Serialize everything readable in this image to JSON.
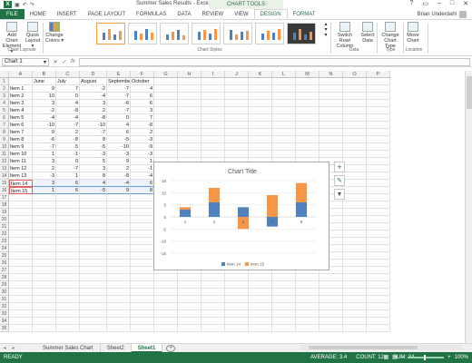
{
  "window": {
    "title": "Summer Sales Results - Excel",
    "chart_tools": "CHART TOOLS",
    "controls": [
      "?",
      "▭",
      "–",
      "□",
      "✕"
    ]
  },
  "user": {
    "name": "Brian Underdahl"
  },
  "tabs": [
    "FILE",
    "HOME",
    "INSERT",
    "PAGE LAYOUT",
    "FORMULAS",
    "DATA",
    "REVIEW",
    "VIEW",
    "DESIGN",
    "FORMAT"
  ],
  "ribbon": {
    "add_chart_element": "Add Chart Element ▾",
    "quick_layout": "Quick Layout ▾",
    "change_colors": "Change Colors ▾",
    "switch_row_column": "Switch Row/ Column",
    "select_data": "Select Data",
    "change_chart_type": "Change Chart Type",
    "move_chart": "Move Chart",
    "groups": {
      "chart_layouts": "Chart Layouts",
      "chart_styles": "Chart Styles",
      "data": "Data",
      "type": "Type",
      "location": "Location"
    }
  },
  "formula_bar": {
    "name_box": "Chart 1",
    "fx_cancel": "✕",
    "fx_ok": "✓",
    "fx": "fx",
    "value": ""
  },
  "columns": [
    "",
    "A",
    "B",
    "C",
    "D",
    "E",
    "F",
    "G",
    "H",
    "I",
    "J",
    "K",
    "L",
    "M",
    "N",
    "O",
    "P"
  ],
  "sheet_rows": [
    {
      "n": "1",
      "cells": [
        "",
        "June",
        "July",
        "August",
        "September",
        "October"
      ]
    },
    {
      "n": "2",
      "cells": [
        "Item 1",
        "9",
        "7",
        "-2",
        "-7",
        "4"
      ]
    },
    {
      "n": "3",
      "cells": [
        "Item 2",
        "10",
        "0",
        "-4",
        "-7",
        "6"
      ]
    },
    {
      "n": "4",
      "cells": [
        "Item 3",
        "3",
        "4",
        "3",
        "-6",
        "6"
      ]
    },
    {
      "n": "5",
      "cells": [
        "Item 4",
        "-2",
        "-8",
        "2",
        "-7",
        "3"
      ]
    },
    {
      "n": "6",
      "cells": [
        "Item 5",
        "-4",
        "-4",
        "-8",
        "0",
        "7"
      ]
    },
    {
      "n": "7",
      "cells": [
        "Item 6",
        "-10",
        "-7",
        "-10",
        "4",
        "-8"
      ]
    },
    {
      "n": "8",
      "cells": [
        "Item 7",
        "9",
        "2",
        "-7",
        "6",
        "2"
      ]
    },
    {
      "n": "9",
      "cells": [
        "Item 8",
        "-6",
        "-8",
        "8",
        "-5",
        "-3"
      ]
    },
    {
      "n": "10",
      "cells": [
        "Item 9",
        "-7",
        "5",
        "-5",
        "-10",
        "-9"
      ]
    },
    {
      "n": "11",
      "cells": [
        "Item 10",
        "1",
        "-1",
        "-3",
        "-3",
        "-3"
      ]
    },
    {
      "n": "12",
      "cells": [
        "Item 11",
        "3",
        "0",
        "5",
        "9",
        "1"
      ]
    },
    {
      "n": "13",
      "cells": [
        "Item 12",
        "2",
        "-7",
        "3",
        "2",
        "-1"
      ]
    },
    {
      "n": "14",
      "cells": [
        "Item 13",
        "-3",
        "1",
        "8",
        "-8",
        "-4"
      ]
    },
    {
      "n": "15",
      "cells": [
        "Item 14",
        "3",
        "6",
        "4",
        "-4",
        "6"
      ]
    },
    {
      "n": "16",
      "cells": [
        "Item 15",
        "1",
        "6",
        "-5",
        "9",
        "8"
      ]
    }
  ],
  "empty_row_numbers": [
    "17",
    "18",
    "19",
    "20",
    "21",
    "22",
    "23",
    "24",
    "25",
    "26",
    "27",
    "28",
    "29",
    "30",
    "31",
    "32",
    "33",
    "34",
    "35"
  ],
  "chart_data": {
    "type": "bar",
    "title": "Chart Title",
    "stacked": true,
    "categories": [
      "1",
      "2",
      "3",
      "4",
      "5"
    ],
    "series": [
      {
        "name": "Item 14",
        "values": [
          3,
          6,
          4,
          -4,
          6
        ],
        "color": "#4f81bd"
      },
      {
        "name": "Item 15",
        "values": [
          1,
          6,
          -5,
          9,
          8
        ],
        "color": "#f79646"
      }
    ],
    "ylim": [
      -15,
      15
    ],
    "yticks": [
      "15",
      "10",
      "5",
      "0",
      "-5",
      "-10",
      "-15"
    ],
    "legend": "bottom",
    "grid": true
  },
  "chart_buttons": [
    "+",
    "✎",
    "▼"
  ],
  "sheets": [
    "Summer Sales Chart",
    "Sheet2",
    "Sheet1"
  ],
  "active_sheet": "Sheet1",
  "status": {
    "ready": "READY",
    "average": "AVERAGE: 3.4",
    "count": "COUNT: 12",
    "sum": "SUM: 34",
    "zoom": "100%"
  }
}
